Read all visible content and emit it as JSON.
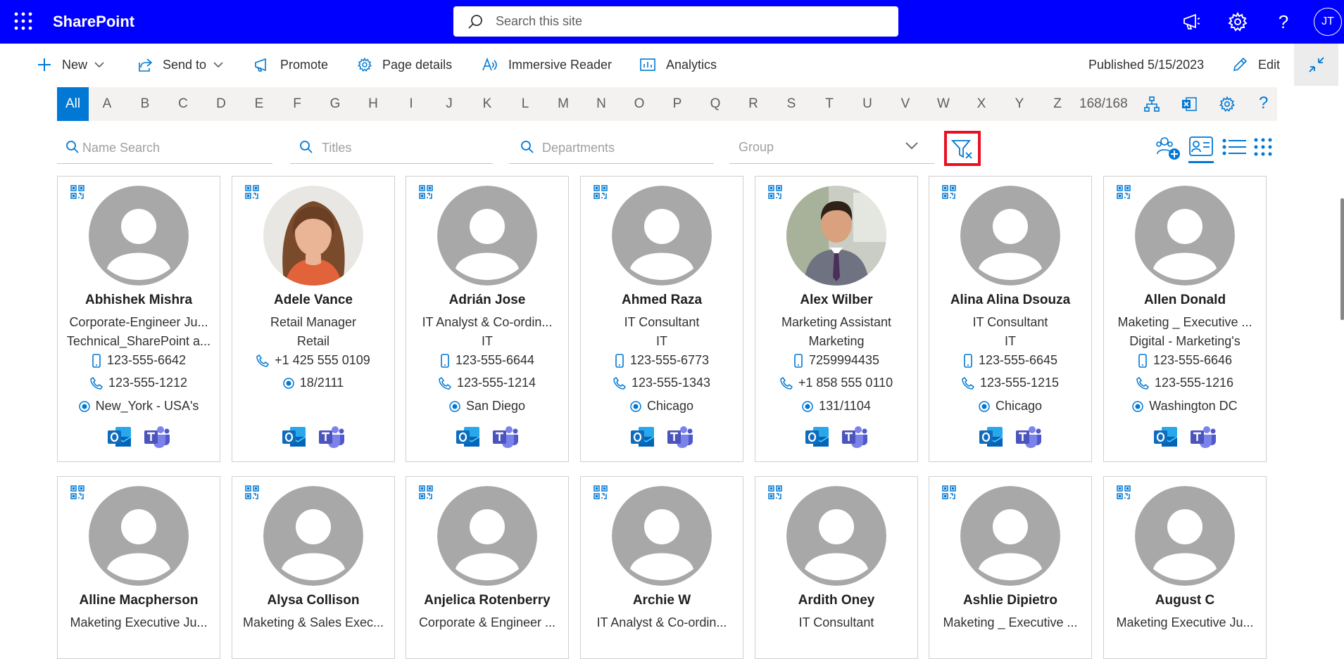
{
  "suite": {
    "brand": "SharePoint",
    "search_placeholder": "Search this site",
    "user_initials": "JT"
  },
  "commands": {
    "new": "New",
    "send_to": "Send to",
    "promote": "Promote",
    "page_details": "Page details",
    "immersive_reader": "Immersive Reader",
    "analytics": "Analytics",
    "published": "Published 5/15/2023",
    "edit": "Edit"
  },
  "alphabet": {
    "letters": [
      "All",
      "A",
      "B",
      "C",
      "D",
      "E",
      "F",
      "G",
      "H",
      "I",
      "J",
      "K",
      "L",
      "M",
      "N",
      "O",
      "P",
      "Q",
      "R",
      "S",
      "T",
      "U",
      "V",
      "W",
      "X",
      "Y",
      "Z"
    ],
    "active": "All",
    "count": "168/168"
  },
  "filters": {
    "name_placeholder": "Name Search",
    "titles_placeholder": "Titles",
    "departments_placeholder": "Departments",
    "group_placeholder": "Group"
  },
  "colors": {
    "suite_bar": "#0000ff",
    "accent": "#0078d4",
    "highlight_border": "#e81123",
    "placeholder_avatar": "#a8a8a8"
  },
  "people": [
    {
      "name": "Abhishek Mishra",
      "title": "Corporate-Engineer Ju...",
      "dept": "Technical_SharePoint a...",
      "mobile": "123-555-6642",
      "phone": "123-555-1212",
      "location": "New_York - USA's",
      "photo": "placeholder"
    },
    {
      "name": "Adele Vance",
      "title": "Retail Manager",
      "dept": "Retail",
      "mobile": "",
      "phone": "+1 425 555 0109",
      "location": "18/2111",
      "photo": "woman"
    },
    {
      "name": "Adrián Jose",
      "title": "IT Analyst & Co-ordin...",
      "dept": "IT",
      "mobile": "123-555-6644",
      "phone": "123-555-1214",
      "location": "San Diego",
      "photo": "placeholder"
    },
    {
      "name": "Ahmed Raza",
      "title": "IT Consultant",
      "dept": "IT",
      "mobile": "123-555-6773",
      "phone": "123-555-1343",
      "location": "Chicago",
      "photo": "placeholder"
    },
    {
      "name": "Alex Wilber",
      "title": "Marketing Assistant",
      "dept": "Marketing",
      "mobile": "7259994435",
      "phone": "+1 858 555 0110",
      "location": "131/1104",
      "photo": "man"
    },
    {
      "name": "Alina Alina Dsouza",
      "title": "IT Consultant",
      "dept": "IT",
      "mobile": "123-555-6645",
      "phone": "123-555-1215",
      "location": "Chicago",
      "photo": "placeholder"
    },
    {
      "name": "Allen Donald",
      "title": "Maketing _ Executive ...",
      "dept": "Digital - Marketing's",
      "mobile": "123-555-6646",
      "phone": "123-555-1216",
      "location": "Washington DC",
      "photo": "placeholder"
    },
    {
      "name": "Alline Macpherson",
      "title": "Maketing Executive Ju...",
      "photo": "placeholder"
    },
    {
      "name": "Alysa Collison",
      "title": "Maketing & Sales Exec...",
      "photo": "placeholder"
    },
    {
      "name": "Anjelica Rotenberry",
      "title": "Corporate & Engineer ...",
      "photo": "placeholder"
    },
    {
      "name": "Archie W",
      "title": "IT Analyst & Co-ordin...",
      "photo": "placeholder"
    },
    {
      "name": "Ardith Oney",
      "title": "IT Consultant",
      "photo": "placeholder"
    },
    {
      "name": "Ashlie Dipietro",
      "title": "Maketing _ Executive ...",
      "photo": "placeholder"
    },
    {
      "name": "August C",
      "title": "Maketing Executive Ju...",
      "photo": "placeholder"
    }
  ]
}
